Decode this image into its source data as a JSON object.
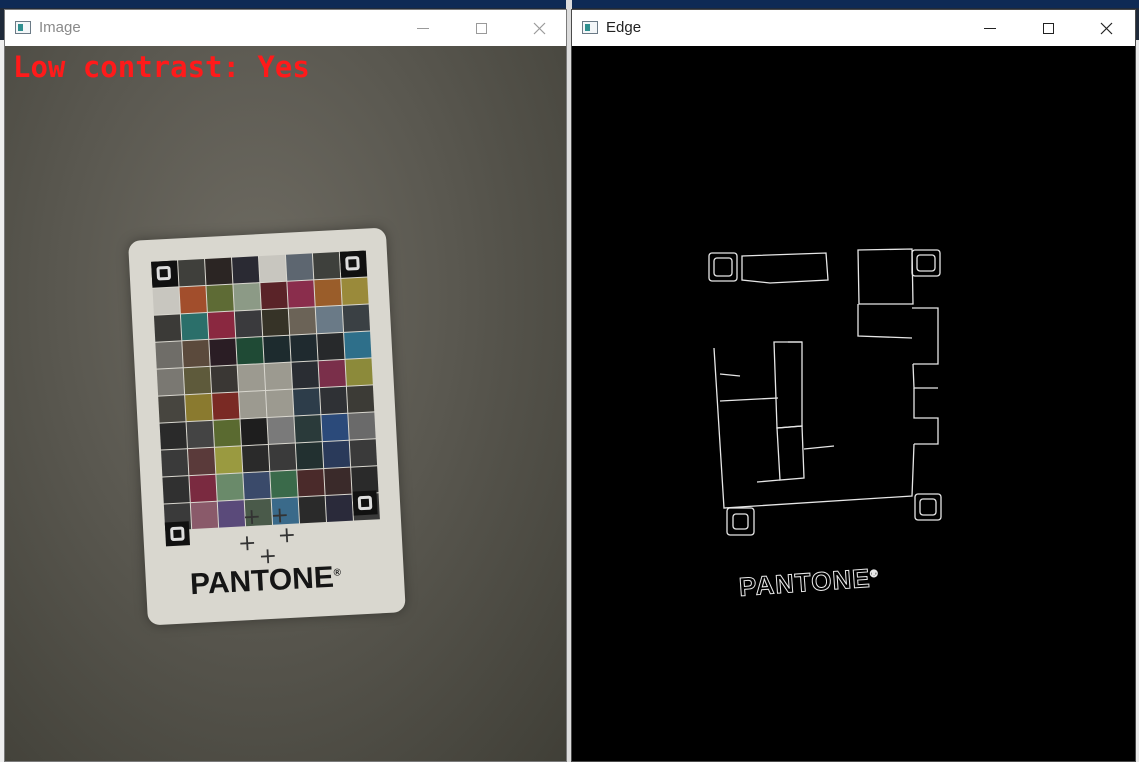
{
  "windows": [
    {
      "title": "Image",
      "state": "inactive",
      "overlay_text": "Low contrast: Yes",
      "overlay_color": "#ff1a1a",
      "card_logo": "PANTONE",
      "card_mark": "®"
    },
    {
      "title": "Edge",
      "state": "active",
      "edge_logo": "PANTONE",
      "edge_mark": "®"
    }
  ],
  "controls": {
    "minimize_icon": "minimize-icon",
    "maximize_icon": "maximize-icon",
    "close_icon": "close-icon"
  },
  "palette": [
    [
      "#111111",
      "#3f3f3b",
      "#2b2523",
      "#2a2a33",
      "#c8c6bf",
      "#5d6670",
      "#3e403c",
      "#111111"
    ],
    [
      "#c8c6bf",
      "#a24e2c",
      "#5e6b35",
      "#8c9a86",
      "#5a2328",
      "#8a2d4c",
      "#9a5d2a",
      "#9a8a3a"
    ],
    [
      "#3b3a37",
      "#2b6f6a",
      "#8a2840",
      "#3a3a3d",
      "#363327",
      "#6b6357",
      "#6a7a87",
      "#3a4044"
    ],
    [
      "#6f6d68",
      "#5b4a3c",
      "#2a1d24",
      "#1f4a35",
      "#1d2b2e",
      "#1f2a2f",
      "#27292b",
      "#2e6f8a"
    ],
    [
      "#7a7872",
      "#5e5a3b",
      "#3a3734",
      "#9c9a90",
      "#9c9a90",
      "#2a2d33",
      "#7a2f4a",
      "#8c8a3a"
    ],
    [
      "#47453f",
      "#8a7a2f",
      "#7a2a24",
      "#9c9a90",
      "#9c9a90",
      "#2d3d4a",
      "#2f3135",
      "#3c3b36"
    ],
    [
      "#2a2a2a",
      "#444444",
      "#5a6a30",
      "#1e1e1e",
      "#7a7a7a",
      "#2a3a3a",
      "#2b4a7a",
      "#6a6a6a"
    ],
    [
      "#3a3a3a",
      "#5a3a3a",
      "#9a9a40",
      "#2a2a2a",
      "#3a3a3a",
      "#223030",
      "#2a3a5a",
      "#3a3a3a"
    ],
    [
      "#303030",
      "#7a2a40",
      "#6a8a6a",
      "#3a4a6a",
      "#3a6a4a",
      "#4a2a2a",
      "#3a2a2a",
      "#2a2a2a"
    ],
    [
      "#3a3a3a",
      "#8a5a6a",
      "#5a4a7a",
      "#4a5a4a",
      "#3a6a8a",
      "#2a2a2a",
      "#2a2a3a",
      "#3a3a3a"
    ]
  ]
}
